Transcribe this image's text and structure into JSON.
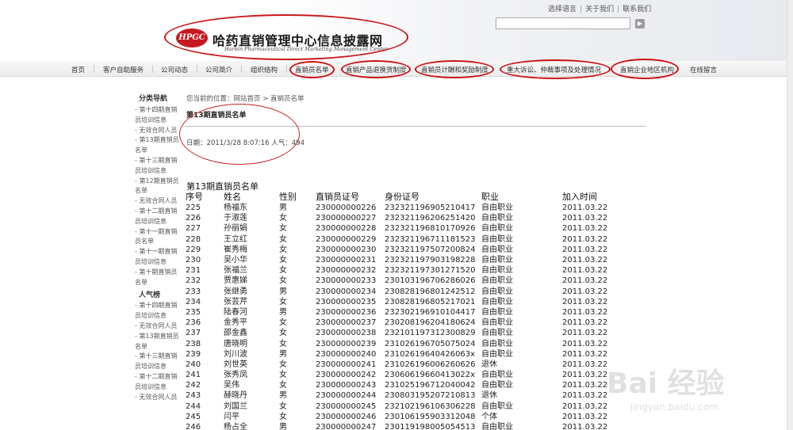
{
  "toplinks": [
    "选择语言",
    "关于我们",
    "联系我们"
  ],
  "logo": {
    "mark": "HPGC",
    "title": "哈药直销管理中心信息披露网",
    "subtitle": "Harbin Pharmaceutical Direct Marketing Management Center"
  },
  "nav": [
    "首页",
    "客户自助服务",
    "公司动态",
    "公司简介",
    "组织结构",
    "直销员名单",
    "直销产品退换货制度",
    "直销员计酬和奖励制度",
    "重大诉讼、仲裁事项及处理情况",
    "直销企业地区机构",
    "在线留言"
  ],
  "sidebar": {
    "heading1": "分类导航",
    "items1": [
      "- 第十四期直销员培训信息",
      "- 无效合同人员",
      "- 第13期直销员名单",
      "- 第十三期直销员培训信息",
      "- 第12期直销员名单",
      "- 无效合同人员",
      "- 第十二期直销员培训信息",
      "- 第十一期直销员名单",
      "- 第十一期直销员培训信息",
      "- 第十期直销员名单"
    ],
    "heading2": "人气榜",
    "items2": [
      "- 第十四期直销员培训信息",
      "- 无效合同人员",
      "- 第13期直销员名单",
      "- 第十三期直销员培训信息",
      "- 第十二期直销员培训信息",
      "- 无效合同人员"
    ]
  },
  "breadcrumb": "您当前的位置：网站首页 > 直销员名单",
  "article": {
    "title": "第13期直销员名单",
    "meta": "日期：2011/3/28 8:07:16 人气：494",
    "list_heading": "第13期直销员名单"
  },
  "table": {
    "headers": [
      "序号",
      "姓名",
      "性别",
      "直销员证号",
      "身份证号",
      "职业",
      "加入时间"
    ],
    "rows": [
      [
        "225",
        "杨福东",
        "男",
        "230000000226",
        "232321196905210417",
        "自由职业",
        "2011.03.22"
      ],
      [
        "226",
        "于淑莲",
        "女",
        "230000000227",
        "232321196206251420",
        "自由职业",
        "2011.03.22"
      ],
      [
        "227",
        "孙丽娟",
        "女",
        "230000000228",
        "232321196810170926",
        "自由职业",
        "2011.03.22"
      ],
      [
        "228",
        "王立红",
        "女",
        "230000000229",
        "232321196711181523",
        "自由职业",
        "2011.03.22"
      ],
      [
        "229",
        "崔秀梅",
        "女",
        "230000000230",
        "232321197507200824",
        "自由职业",
        "2011.03.22"
      ],
      [
        "230",
        "吴小华",
        "女",
        "230000000231",
        "232321197903198228",
        "自由职业",
        "2011.03.22"
      ],
      [
        "231",
        "张福兰",
        "女",
        "230000000232",
        "232321197301271520",
        "自由职业",
        "2011.03.22"
      ],
      [
        "232",
        "贾惠娣",
        "女",
        "230000000233",
        "230103196706286026",
        "自由职业",
        "2011.03.22"
      ],
      [
        "233",
        "张继勇",
        "男",
        "230000000234",
        "230828196801242512",
        "自由职业",
        "2011.03.22"
      ],
      [
        "234",
        "张芸芹",
        "女",
        "230000000235",
        "230828196805217021",
        "自由职业",
        "2011.03.22"
      ],
      [
        "235",
        "陆春河",
        "男",
        "230000000236",
        "232302196910104417",
        "自由职业",
        "2011.03.22"
      ],
      [
        "236",
        "金秀平",
        "女",
        "230000000237",
        "230208196204180624",
        "自由职业",
        "2011.03.22"
      ],
      [
        "237",
        "邵金鑫",
        "女",
        "230000000238",
        "232101197312300829",
        "自由职业",
        "2011.03.22"
      ],
      [
        "238",
        "唐晓明",
        "女",
        "230000000239",
        "231026196705075024",
        "自由职业",
        "2011.03.22"
      ],
      [
        "239",
        "刘川波",
        "男",
        "230000000240",
        "23102619640426063x",
        "自由职业",
        "2011.03.22"
      ],
      [
        "240",
        "刘世英",
        "女",
        "230000000241",
        "231026196006260626",
        "退休",
        "2011.03.22"
      ],
      [
        "241",
        "张秀凤",
        "女",
        "230000000242",
        "23060619660413022x",
        "自由职业",
        "2011.03.22"
      ],
      [
        "242",
        "吴伟",
        "女",
        "230000000243",
        "231025196712040042",
        "自由职业",
        "2011.03.22"
      ],
      [
        "243",
        "赫晓丹",
        "男",
        "230000000244",
        "230803195207210813",
        "退休",
        "2011.03.22"
      ],
      [
        "244",
        "刘国兰",
        "女",
        "230000000245",
        "232102196106306228",
        "自由职业",
        "2011.03.22"
      ],
      [
        "245",
        "闫平",
        "女",
        "230000000246",
        "230106195903312048",
        "个体",
        "2011.03.22"
      ],
      [
        "246",
        "杨占全",
        "男",
        "230000000247",
        "230119198005054513",
        "自由职业",
        "2011.03.22"
      ]
    ]
  },
  "watermark": {
    "main": "Bai 经验",
    "sub": "jingyan.baidu.com"
  },
  "colors": {
    "annotation_red": "#cc1111",
    "logo_red": "#c41a1f"
  }
}
